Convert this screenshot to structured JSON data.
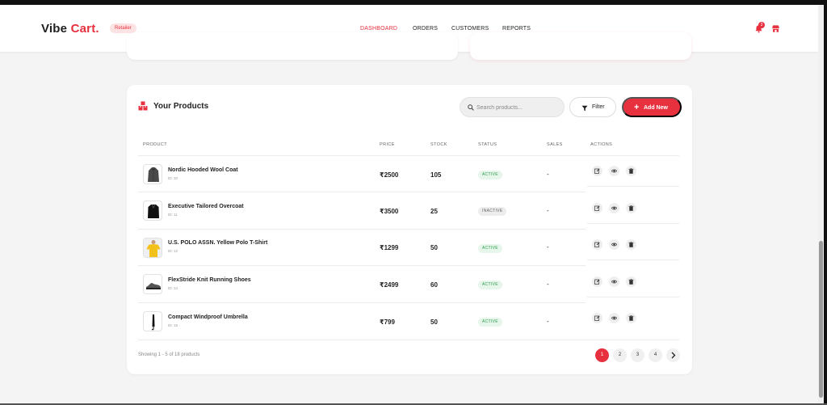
{
  "brand": {
    "name_part1": "Vibe ",
    "name_part2": "Cart.",
    "role_badge": "Retailer"
  },
  "nav": {
    "items": [
      "DASHBOARD",
      "ORDERS",
      "CUSTOMERS",
      "REPORTS"
    ],
    "active": "DASHBOARD"
  },
  "header_icons": {
    "notification_icon": "bell-icon",
    "notification_count": "3",
    "store_icon": "store-icon"
  },
  "colors": {
    "accent": "#e8313f",
    "active_status": "#2c9b4c",
    "background": "#f4f4f4"
  },
  "products_panel": {
    "title": "Your Products",
    "title_icon": "boxes-icon",
    "search_placeholder": "Search products...",
    "filter_label": "Filter",
    "add_label": "Add New",
    "columns": [
      "PRODUCT",
      "PRICE",
      "STOCK",
      "STATUS",
      "SALES",
      "ACTIONS"
    ],
    "rows": [
      {
        "name": "Nordic Hooded Wool Coat",
        "id": "ID: 10",
        "price": "₹2500",
        "stock": "105",
        "status": "ACTIVE",
        "sales": "-",
        "image": "coat-icon"
      },
      {
        "name": "Executive Tailored Overcoat",
        "id": "ID: 11",
        "price": "₹3500",
        "stock": "25",
        "status": "INACTIVE",
        "sales": "-",
        "image": "overcoat-icon"
      },
      {
        "name": "U.S. POLO ASSN. Yellow Polo T-Shirt",
        "id": "ID: 12",
        "price": "₹1299",
        "stock": "50",
        "status": "ACTIVE",
        "sales": "-",
        "image": "polo-shirt-icon"
      },
      {
        "name": "FlexStride Knit Running Shoes",
        "id": "ID: 14",
        "price": "₹2499",
        "stock": "60",
        "status": "ACTIVE",
        "sales": "-",
        "image": "shoe-icon"
      },
      {
        "name": "Compact Windproof Umbrella",
        "id": "ID: 15",
        "price": "₹799",
        "stock": "50",
        "status": "ACTIVE",
        "sales": "-",
        "image": "umbrella-icon"
      }
    ],
    "row_actions": [
      "edit-icon",
      "view-icon",
      "delete-icon"
    ],
    "showing_text": "Showing 1 - 5 of 18 products",
    "pagination": {
      "pages": [
        "1",
        "2",
        "3",
        "4"
      ],
      "current": "1",
      "next_icon": "chevron-right-icon"
    }
  }
}
